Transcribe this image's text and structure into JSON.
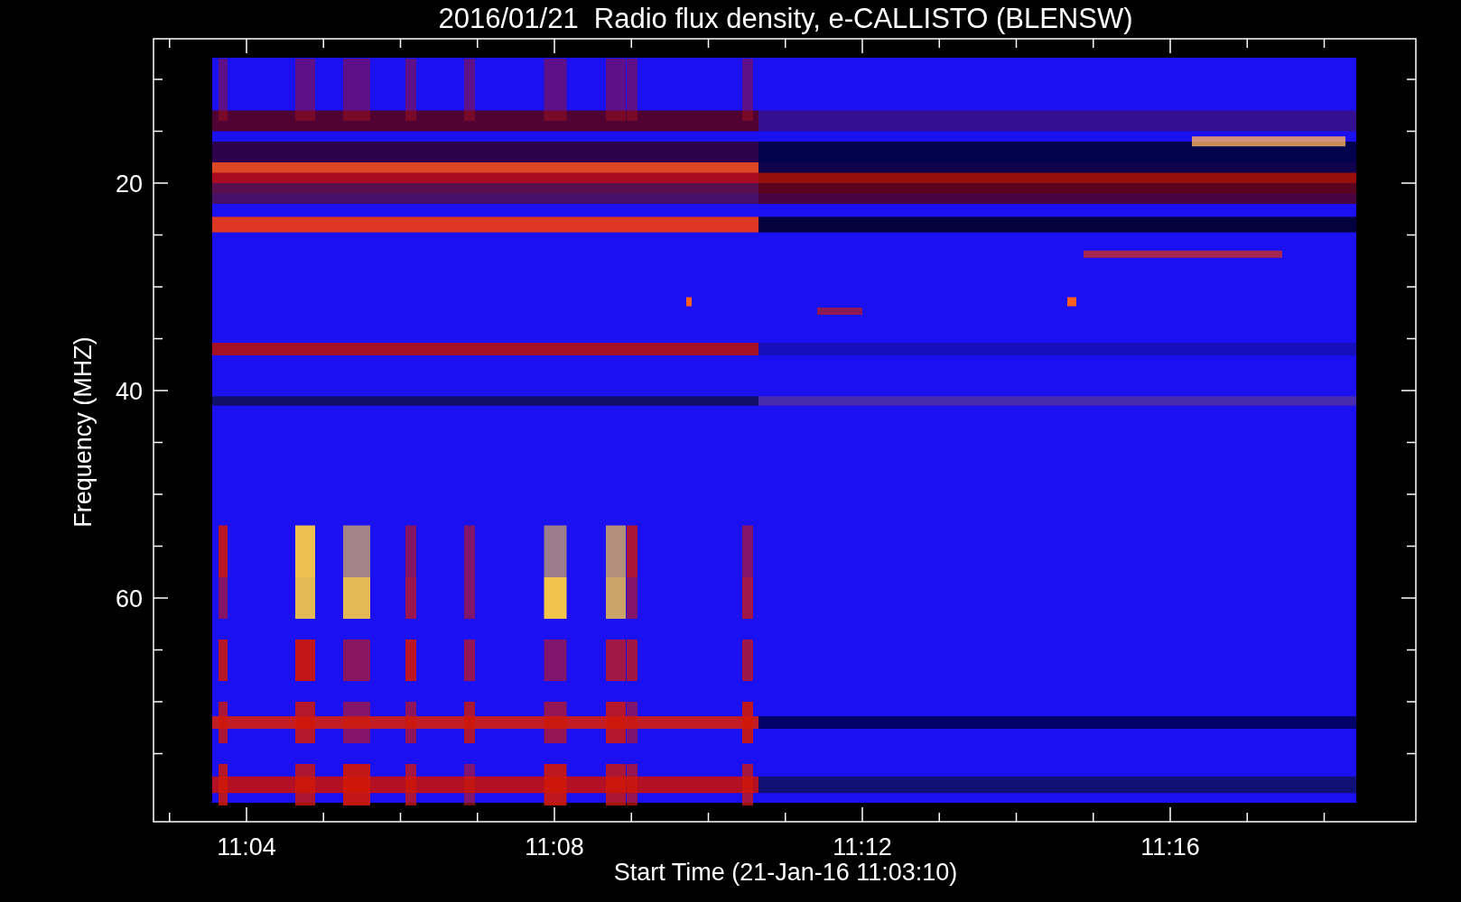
{
  "title": "2016/01/21  Radio flux density, e-CALLISTO (BLENSW)",
  "y_axis": {
    "label": "Frequency (MHZ)",
    "ticks": [
      "20",
      "40",
      "60"
    ]
  },
  "x_axis": {
    "label": "Start Time (21-Jan-16 11:03:10)",
    "ticks": [
      "11:04",
      "11:08",
      "11:12",
      "11:16"
    ]
  }
}
